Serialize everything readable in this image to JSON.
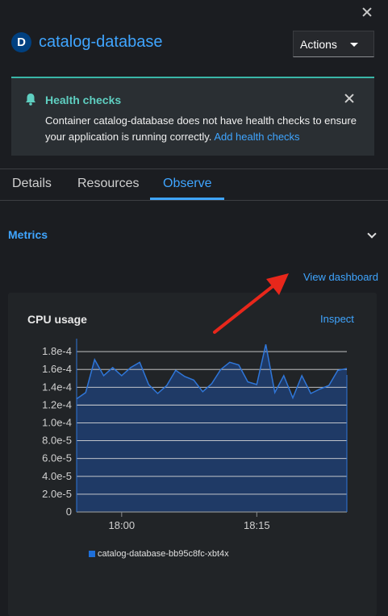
{
  "header": {
    "badge": "D",
    "title": "catalog-database",
    "actions_label": "Actions"
  },
  "alert": {
    "title": "Health checks",
    "body": "Container catalog-database does not have health checks to ensure your application is running correctly. ",
    "link": "Add health checks"
  },
  "tabs": [
    {
      "label": "Details"
    },
    {
      "label": "Resources"
    },
    {
      "label": "Observe"
    }
  ],
  "active_tab": "Observe",
  "metrics": {
    "section_label": "Metrics",
    "view_dashboard": "View dashboard"
  },
  "card": {
    "title": "CPU usage",
    "inspect": "Inspect",
    "legend": "catalog-database-bb95c8fc-xbt4x"
  },
  "colors": {
    "accent": "#3fa5ff",
    "alert_border": "#3ab6a8",
    "series_fill": "#1f3a66",
    "series_line": "#2f76d8",
    "annotation_arrow": "#e8271b"
  },
  "chart_data": {
    "type": "area",
    "title": "CPU usage",
    "xlabel": "",
    "ylabel": "",
    "x_ticks": [
      "18:00",
      "18:15"
    ],
    "y_ticks": [
      "0",
      "2.0e-5",
      "4.0e-5",
      "6.0e-5",
      "8.0e-5",
      "1.0e-4",
      "1.2e-4",
      "1.4e-4",
      "1.6e-4",
      "1.8e-4"
    ],
    "ylim": [
      0,
      0.00019
    ],
    "x_minutes_from_first_tick": [
      -5,
      -4,
      -3,
      -2,
      -1,
      0,
      1,
      2,
      3,
      4,
      5,
      6,
      7,
      8,
      9,
      10,
      11,
      12,
      13,
      14,
      15,
      16,
      17,
      18,
      19,
      20,
      21,
      22,
      23,
      24,
      25
    ],
    "grid": true,
    "series": [
      {
        "name": "catalog-database-bb95c8fc-xbt4x",
        "values": [
          0.000127,
          0.000134,
          0.000171,
          0.000153,
          0.000162,
          0.000153,
          0.000162,
          0.000168,
          0.000143,
          0.000133,
          0.000142,
          0.000159,
          0.000152,
          0.000148,
          0.000135,
          0.000144,
          0.00016,
          0.000168,
          0.000165,
          0.000146,
          0.000143,
          0.000188,
          0.000134,
          0.000153,
          0.000128,
          0.000153,
          0.000133,
          0.000138,
          0.000142,
          0.000159,
          0.000161
        ]
      }
    ]
  }
}
